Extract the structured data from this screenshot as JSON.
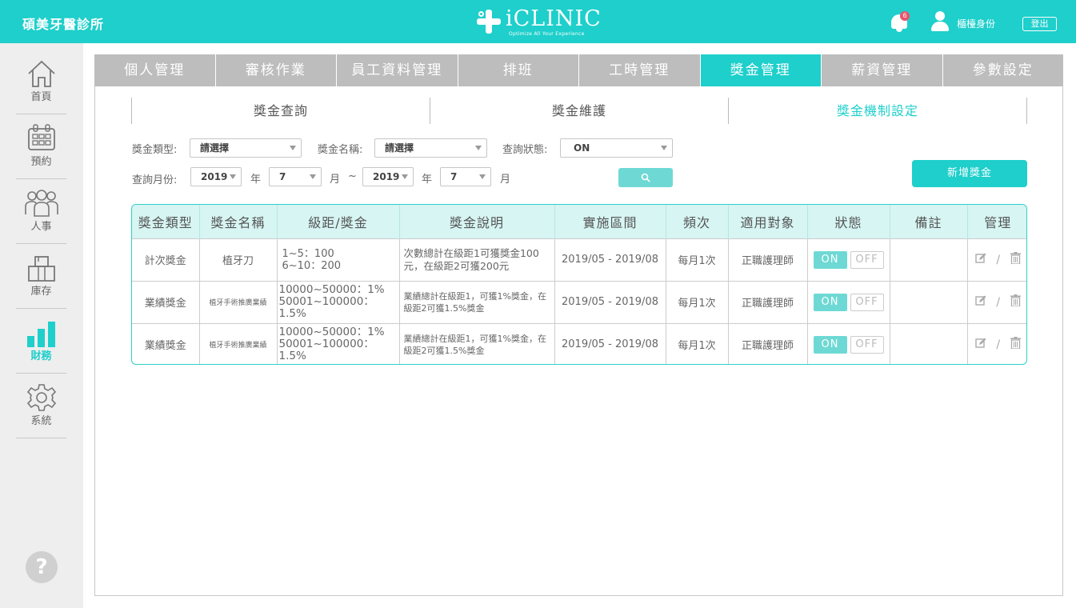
{
  "header": {
    "clinic_name": "碩美牙醫診所",
    "logo_title": "iCLINIC",
    "logo_subtitle": "Optimize All Your Experience",
    "notification_count": "6",
    "role_label": "櫃檯身份",
    "logout_label": "登出"
  },
  "sidebar": {
    "items": [
      {
        "label": "首頁",
        "icon": "home-icon"
      },
      {
        "label": "預約",
        "icon": "calendar-icon"
      },
      {
        "label": "人事",
        "icon": "people-icon"
      },
      {
        "label": "庫存",
        "icon": "inventory-icon"
      },
      {
        "label": "財務",
        "icon": "bar-chart-icon",
        "active": true
      },
      {
        "label": "系統",
        "icon": "gear-icon"
      }
    ],
    "help_label": "?"
  },
  "tabs": [
    {
      "label": "個人管理"
    },
    {
      "label": "審核作業"
    },
    {
      "label": "員工資料管理"
    },
    {
      "label": "排班"
    },
    {
      "label": "工時管理"
    },
    {
      "label": "獎金管理",
      "active": true
    },
    {
      "label": "薪資管理"
    },
    {
      "label": "參數設定"
    }
  ],
  "subtabs": [
    {
      "label": "獎金查詢"
    },
    {
      "label": "獎金維護"
    },
    {
      "label": "獎金機制設定",
      "active": true
    }
  ],
  "filters": {
    "bonus_type_label": "獎金類型:",
    "bonus_type_value": "請選擇",
    "bonus_name_label": "獎金名稱:",
    "bonus_name_value": "請選擇",
    "status_label": "查詢狀態:",
    "status_value": "ON",
    "month_label": "查詢月份:",
    "from_year": "2019",
    "year_unit": "年",
    "from_month": "7",
    "month_unit": "月",
    "range_sep": "~",
    "to_year": "2019",
    "to_month": "7"
  },
  "add_button_label": "新增獎金",
  "table": {
    "headers": [
      "獎金類型",
      "獎金名稱",
      "級距/獎金",
      "獎金說明",
      "實施區間",
      "頻次",
      "適用對象",
      "狀態",
      "備註",
      "管理"
    ],
    "rows": [
      {
        "type": "計次獎金",
        "name": "植牙刀",
        "tier1": "1~5：100",
        "tier2": "6~10：200",
        "desc": "次數總計在級距1可獲獎金100元，在級距2可獲200元",
        "period": "2019/05 - 2019/08",
        "freq": "每月1次",
        "target": "正職護理師",
        "on": "ON",
        "off": "OFF",
        "note": "",
        "slash": "/"
      },
      {
        "type": "業績獎金",
        "name": "植牙手術推廣業績",
        "tier1": "10000~50000：1%",
        "tier2": "50001~100000：1.5%",
        "desc": "業績總計在級距1，可獲1%獎金，在級距2可獲1.5%獎金",
        "period": "2019/05 - 2019/08",
        "freq": "每月1次",
        "target": "正職護理師",
        "on": "ON",
        "off": "OFF",
        "note": "",
        "slash": "/"
      },
      {
        "type": "業績獎金",
        "name": "植牙手術推廣業績",
        "tier1": "10000~50000：1%",
        "tier2": "50001~100000：1.5%",
        "desc": "業績總計在級距1，可獲1%獎金，在級距2可獲1.5%獎金",
        "period": "2019/05 - 2019/08",
        "freq": "每月1次",
        "target": "正職護理師",
        "on": "ON",
        "off": "OFF",
        "note": "",
        "slash": "/"
      }
    ]
  },
  "colors": {
    "accent": "#1ecfcb",
    "tab_inactive": "#bdbdbd",
    "toggle_on": "#6ed9d4",
    "badge": "#e8556b"
  }
}
